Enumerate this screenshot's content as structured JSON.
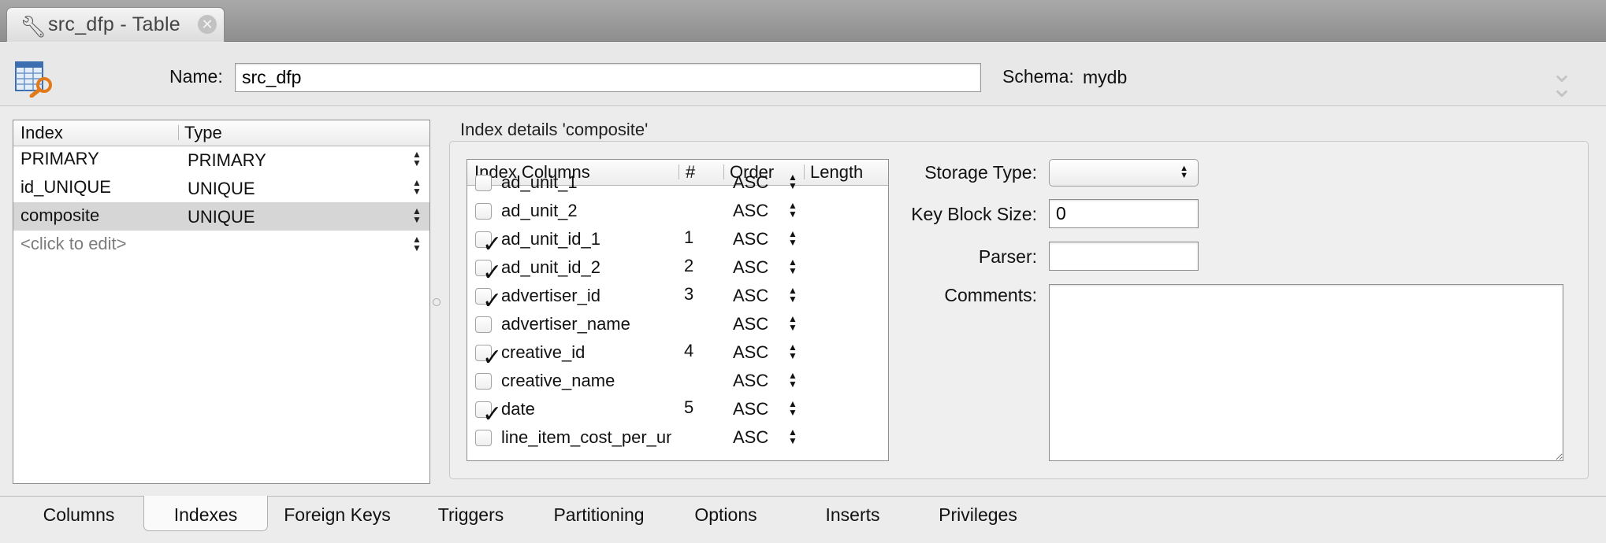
{
  "window_tab": {
    "title": "src_dfp - Table",
    "icon": "wrench-icon",
    "close_icon": "close-icon"
  },
  "header": {
    "name_label": "Name:",
    "name_value": "src_dfp",
    "schema_label": "Schema:",
    "schema_value": "mydb",
    "collapse_icon": "double-chevron-down-icon"
  },
  "index_list": {
    "columns": [
      "Index",
      "Type"
    ],
    "rows": [
      {
        "name": "PRIMARY",
        "type": "PRIMARY"
      },
      {
        "name": "id_UNIQUE",
        "type": "UNIQUE"
      },
      {
        "name": "composite",
        "type": "UNIQUE",
        "selected": true
      }
    ],
    "placeholder": "<click to edit>"
  },
  "details": {
    "title": "Index details 'composite'",
    "columns_grid": {
      "headers": [
        "Index Columns",
        "#",
        "Order",
        "Length"
      ],
      "rows": [
        {
          "name": "ad_unit_1",
          "checked": false,
          "num": "",
          "order": "ASC"
        },
        {
          "name": "ad_unit_2",
          "checked": false,
          "num": "",
          "order": "ASC"
        },
        {
          "name": "ad_unit_id_1",
          "checked": true,
          "num": "1",
          "order": "ASC"
        },
        {
          "name": "ad_unit_id_2",
          "checked": true,
          "num": "2",
          "order": "ASC"
        },
        {
          "name": "advertiser_id",
          "checked": true,
          "num": "3",
          "order": "ASC"
        },
        {
          "name": "advertiser_name",
          "checked": false,
          "num": "",
          "order": "ASC"
        },
        {
          "name": "creative_id",
          "checked": true,
          "num": "4",
          "order": "ASC"
        },
        {
          "name": "creative_name",
          "checked": false,
          "num": "",
          "order": "ASC"
        },
        {
          "name": "date",
          "checked": true,
          "num": "5",
          "order": "ASC"
        },
        {
          "name": "line_item_cost_per_unit",
          "checked": false,
          "num": "",
          "order": "ASC"
        }
      ]
    },
    "storage_type_label": "Storage Type:",
    "storage_type_value": "",
    "key_block_size_label": "Key Block Size:",
    "key_block_size_value": "0",
    "parser_label": "Parser:",
    "parser_value": "",
    "comments_label": "Comments:",
    "comments_value": ""
  },
  "bottom_tabs": {
    "items": [
      "Columns",
      "Indexes",
      "Foreign Keys",
      "Triggers",
      "Partitioning",
      "Options",
      "Inserts",
      "Privileges"
    ],
    "active": "Indexes"
  },
  "colors": {
    "selected_row": "#d6d6d6",
    "panel_bg": "#efefef",
    "tabbar": "#9a9a9a"
  }
}
